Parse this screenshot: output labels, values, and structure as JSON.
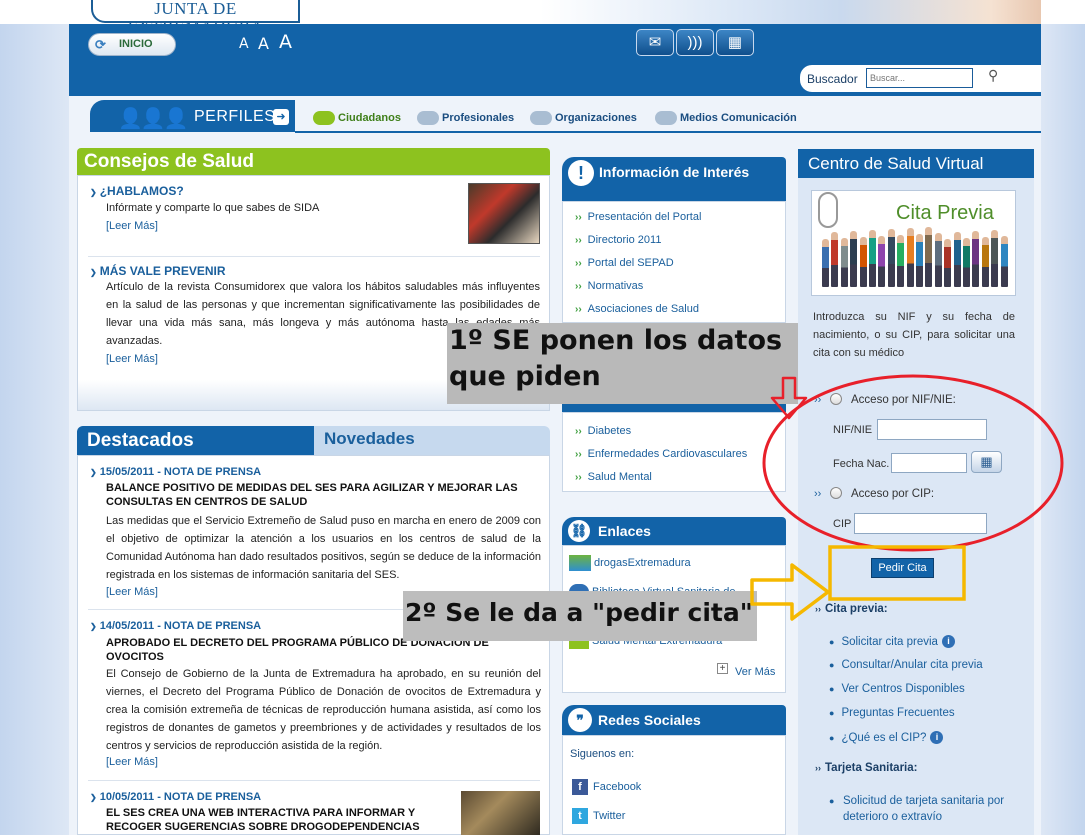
{
  "header": {
    "logo_text": "JUNTA DE EXTREMADURA",
    "inicio_label": "INICIO",
    "font_sizes": [
      "A",
      "A",
      "A"
    ],
    "buscador_label": "Buscador",
    "search_placeholder": "Buscar..."
  },
  "perfiles": {
    "label": "PERFILES",
    "items": [
      "Ciudadanos",
      "Profesionales",
      "Organizaciones",
      "Medios Comunicación"
    ]
  },
  "consejos": {
    "title": "Consejos de Salud",
    "items": [
      {
        "title": "¿HABLAMOS?",
        "text": "Infórmate y comparte lo que sabes de SIDA",
        "more": "[Leer Más]"
      },
      {
        "title": "MÁS VALE PREVENIR",
        "text": "Artículo de la revista Consumidorex que valora los hábitos saludables más influyentes en la salud de las personas y que incrementan significativamente las posibilidades de llevar una vida más sana, más longeva y más autónoma hasta las edades más avanzadas.",
        "more": "[Leer Más]"
      }
    ]
  },
  "destacados": {
    "title": "Destacados",
    "tab2": "Novedades",
    "notas": [
      {
        "date": "15/05/2011 - NOTA DE PRENSA",
        "head": "BALANCE POSITIVO DE MEDIDAS DEL SES PARA AGILIZAR Y MEJORAR LAS CONSULTAS EN CENTROS DE SALUD",
        "text": "Las medidas que el Servicio Extremeño de Salud puso en marcha en enero de 2009 con el objetivo de optimizar la atención a los usuarios en los centros de salud de la Comunidad Autónoma han dado resultados positivos, según se deduce de la información registrada en los sistemas de información sanitaria del SES.",
        "more": "[Leer Más]"
      },
      {
        "date": "14/05/2011 - NOTA DE PRENSA",
        "head": "APROBADO EL DECRETO DEL PROGRAMA PÚBLICO DE DONACIÓN DE OVOCITOS",
        "text": "El Consejo de Gobierno de la Junta de Extremadura ha aprobado, en su reunión del viernes, el Decreto del Programa Público de Donación de ovocitos de Extremadura y crea la comisión extremeña de técnicas de reproducción humana asistida, así como los registros de donantes de gametos y preembriones y de actividades y resultados de los centros y servicios de reproducción asistida de la región.",
        "more": "[Leer Más]"
      },
      {
        "date": "10/05/2011 - NOTA DE PRENSA",
        "head": "EL SES CREA UNA WEB INTERACTIVA PARA INFORMAR Y RECOGER SUGERENCIAS SOBRE DROGODEPENDENCIAS",
        "text": "",
        "more": ""
      }
    ]
  },
  "info": {
    "title": "Información de Interés",
    "links": [
      "Presentación del Portal",
      "Directorio 2011",
      "Portal del SEPAD",
      "Normativas",
      "Asociaciones de Salud"
    ],
    "links2": [
      "Diabetes",
      "Enfermedades Cardiovasculares",
      "Salud Mental"
    ]
  },
  "enlaces": {
    "title": "Enlaces",
    "items": [
      "drogasExtremadura",
      "Biblioteca Virtual Sanitaria de",
      "Salud Mental Extremadura"
    ],
    "ver_mas": "Ver Más"
  },
  "redes": {
    "title": "Redes Sociales",
    "siguenos": "Siguenos en:",
    "items": [
      "Facebook",
      "Twitter"
    ]
  },
  "csv": {
    "title": "Centro de Salud Virtual",
    "cita_title": "Cita Previa",
    "intro": "Introduzca su NIF y su fecha de nacimiento, o su CIP, para solicitar una cita con su médico",
    "acceso_nif": "Acceso por NIF/NIE:",
    "nif_label": "NIF/NIE",
    "fecha_label": "Fecha Nac.",
    "acceso_cip": "Acceso por CIP:",
    "cip_label": "CIP",
    "pedir": "Pedir Cita",
    "cita_previa_head": "Cita previa:",
    "cita_links": [
      "Solicitar cita previa",
      "Consultar/Anular cita previa",
      "Ver Centros Disponibles",
      "Preguntas Frecuentes",
      "¿Qué es el CIP?"
    ],
    "tarjeta_head": "Tarjeta Sanitaria:",
    "tarjeta_links": [
      "Solicitud de tarjeta sanitaria por deterioro o extravío"
    ]
  },
  "annotations": {
    "step1": "1º SE ponen los datos que piden",
    "step2": "2º Se le da a \"pedir cita\""
  },
  "colors": {
    "brand_blue": "#1263a8",
    "consejos_green": "#8dc21f",
    "annotation_red": "#e8202a",
    "annotation_yellow": "#f5b800"
  }
}
